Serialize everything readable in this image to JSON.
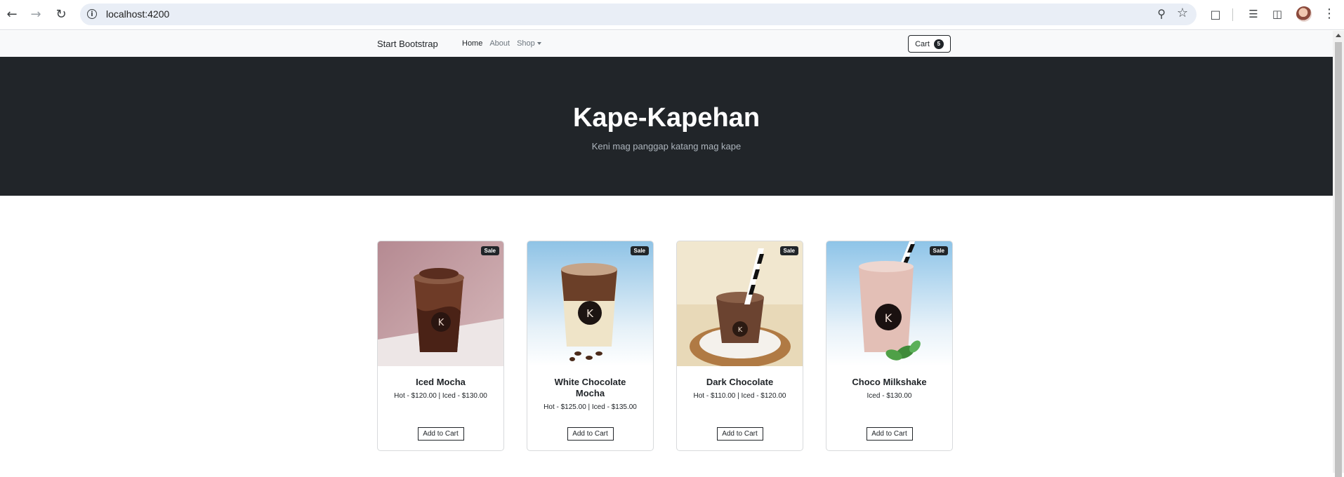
{
  "browser": {
    "url": "localhost:4200"
  },
  "navbar": {
    "brand": "Start Bootstrap",
    "links": [
      {
        "label": "Home"
      },
      {
        "label": "About"
      },
      {
        "label": "Shop"
      }
    ],
    "cart": {
      "label": "Cart",
      "count": "5"
    }
  },
  "hero": {
    "title": "Kape-Kapehan",
    "subtitle": "Keni mag panggap katang mag kape"
  },
  "products": [
    {
      "name": "Iced Mocha",
      "price": "Hot - $120.00 | Iced - $130.00",
      "badge": "Sale",
      "button": "Add to Cart"
    },
    {
      "name": "White Chocolate Mocha",
      "price": "Hot - $125.00 | Iced - $135.00",
      "badge": "Sale",
      "button": "Add to Cart"
    },
    {
      "name": "Dark Chocolate",
      "price": "Hot - $110.00 | Iced - $120.00",
      "badge": "Sale",
      "button": "Add to Cart"
    },
    {
      "name": "Choco Milkshake",
      "price": "Iced - $130.00",
      "badge": "Sale",
      "button": "Add to Cart"
    }
  ],
  "colors": {
    "hero_bg": "#212529",
    "navbar_bg": "#f8f9fa",
    "accent": "#212529"
  }
}
